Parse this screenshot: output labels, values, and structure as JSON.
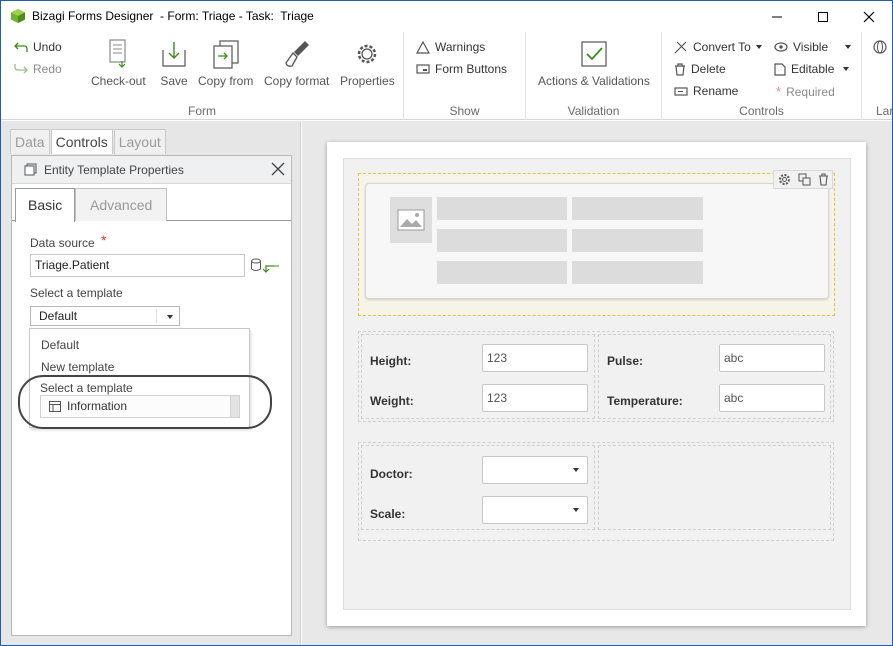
{
  "window": {
    "title": "Bizagi Forms Designer  - Form: Triage - Task:  Triage"
  },
  "ribbon": {
    "undo": "Undo",
    "redo": "Redo",
    "checkout": "Check-out",
    "save": "Save",
    "copy_from": "Copy from",
    "copy_format": "Copy format",
    "properties": "Properties",
    "form_group": "Form",
    "warnings": "Warnings",
    "form_buttons": "Form Buttons",
    "show_group": "Show",
    "actions_validations": "Actions & Validations",
    "validation_group": "Validation",
    "convert_to": "Convert To",
    "delete": "Delete",
    "rename": "Rename",
    "visible": "Visible",
    "editable": "Editable",
    "required": "Required",
    "controls_group": "Controls",
    "cut_group": "Lar"
  },
  "left_panel": {
    "tabs": [
      "Data",
      "Controls",
      "Layout"
    ],
    "header": "Entity Template Properties",
    "subtabs": [
      "Basic",
      "Advanced"
    ],
    "data_source_label": "Data source",
    "required_mark": "*",
    "data_source_value": "Triage.Patient",
    "select_template_label": "Select a template",
    "select_value": "Default",
    "dropdown": {
      "items": [
        "Default",
        "New template"
      ],
      "section_label": "Select a template",
      "highlight_item": "Information"
    }
  },
  "form": {
    "fields_left": [
      {
        "label": "Height:",
        "value": "123"
      },
      {
        "label": "Weight:",
        "value": "123"
      }
    ],
    "fields_right": [
      {
        "label": "Pulse:",
        "value": "abc"
      },
      {
        "label": "Temperature:",
        "value": "abc"
      }
    ],
    "lower_fields": [
      {
        "label": "Doctor:"
      },
      {
        "label": "Scale:"
      }
    ]
  },
  "colors": {
    "accent": "#3b8c1a",
    "selection": "#e6c341",
    "required": "#e03030"
  }
}
